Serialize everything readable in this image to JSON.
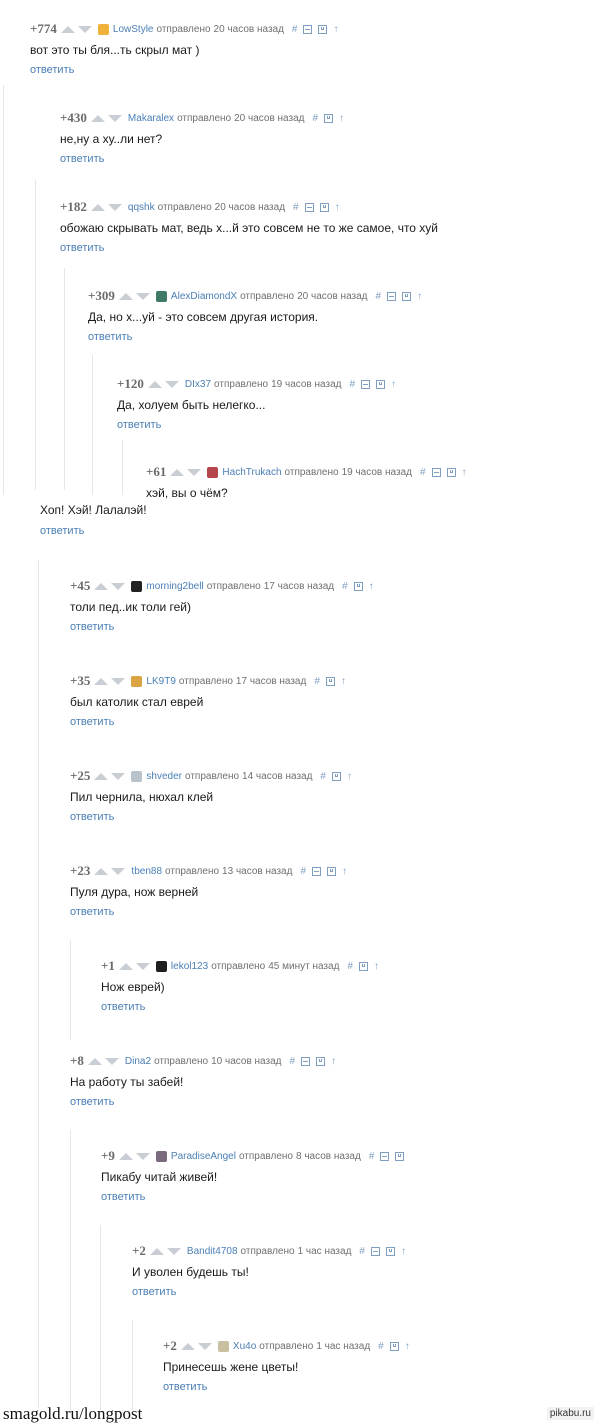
{
  "comments": [
    {
      "score": "+774",
      "nick": "LowStyle",
      "meta": "отправлено",
      "time": "20 часов назад",
      "text": "вот это ты бля...ть скрыл мат )",
      "reply": "ответить",
      "icons": [
        "hash",
        "minus",
        "save",
        "up"
      ],
      "avatar": "#f0b23a"
    },
    {
      "score": "+430",
      "nick": "Makaralex",
      "meta": "отправлено",
      "time": "20 часов назад",
      "text": "не,ну а ху..ли нет?",
      "reply": "ответить",
      "icons": [
        "hash",
        "save",
        "up"
      ],
      "avatar": ""
    },
    {
      "score": "+182",
      "nick": "qqshk",
      "meta": "отправлено",
      "time": "20 часов назад",
      "text": "обожаю скрывать мат, ведь х...й это совсем не то же самое, что хуй",
      "reply": "ответить",
      "icons": [
        "hash",
        "minus",
        "save",
        "up"
      ],
      "avatar": ""
    },
    {
      "score": "+309",
      "nick": "AlexDiamondX",
      "meta": "отправлено",
      "time": "20 часов назад",
      "text": "Да, но х...уй - это совсем другая история.",
      "reply": "ответить",
      "icons": [
        "hash",
        "minus",
        "save",
        "up"
      ],
      "avatar": "#3f7b64"
    },
    {
      "score": "+120",
      "nick": "DIx37",
      "meta": "отправлено",
      "time": "19 часов назад",
      "text": "Да, холуем быть нелегко...",
      "reply": "ответить",
      "icons": [
        "hash",
        "minus",
        "save",
        "up"
      ],
      "avatar": ""
    },
    {
      "score": "+61",
      "nick": "HachTrukach",
      "meta": "отправлено",
      "time": "19 часов назад",
      "text": "хэй, вы о чём?",
      "reply": "",
      "icons": [
        "hash",
        "minus",
        "save",
        "up"
      ],
      "avatar": "#b5474c"
    },
    {
      "score": "+45",
      "nick": "morning2bell",
      "meta": "отправлено",
      "time": "17 часов назад",
      "text": "толи пед..ик толи гей)",
      "reply": "ответить",
      "icons": [
        "hash",
        "save",
        "up"
      ],
      "avatar": "#222222"
    },
    {
      "score": "+35",
      "nick": "LK9T9",
      "meta": "отправлено",
      "time": "17 часов назад",
      "text": "был католик стал еврей",
      "reply": "ответить",
      "icons": [
        "hash",
        "save",
        "up"
      ],
      "avatar": "#d9a441"
    },
    {
      "score": "+25",
      "nick": "shveder",
      "meta": "отправлено",
      "time": "14 часов назад",
      "text": "Пил чернила, нюхал клей",
      "reply": "ответить",
      "icons": [
        "hash",
        "save",
        "up"
      ],
      "avatar": "#b9c3cc"
    },
    {
      "score": "+23",
      "nick": "tben88",
      "meta": "отправлено",
      "time": "13 часов назад",
      "text": "Пуля дура, нож верней",
      "reply": "ответить",
      "icons": [
        "hash",
        "minus",
        "save",
        "up"
      ],
      "avatar": ""
    },
    {
      "score": "+1",
      "nick": "lekol123",
      "meta": "отправлено",
      "time": "45 минут назад",
      "text": "Нож еврей)",
      "reply": "ответить",
      "icons": [
        "hash",
        "save",
        "up"
      ],
      "avatar": "#1e1e1e"
    },
    {
      "score": "+8",
      "nick": "Dina2",
      "meta": "отправлено",
      "time": "10 часов назад",
      "text": "На работу ты забей!",
      "reply": "ответить",
      "icons": [
        "hash",
        "minus",
        "save",
        "up"
      ],
      "avatar": ""
    },
    {
      "score": "+9",
      "nick": "ParadiseAngel",
      "meta": "отправлено",
      "time": "8 часов назад",
      "text": "Пикабу читай живей!",
      "reply": "ответить",
      "icons": [
        "hash",
        "minus",
        "save"
      ],
      "avatar": "#7a6a7e"
    },
    {
      "score": "+2",
      "nick": "Bandit4708",
      "meta": "отправлено",
      "time": "1 час назад",
      "text": "И уволен будешь ты!",
      "reply": "ответить",
      "icons": [
        "hash",
        "minus",
        "save",
        "up"
      ],
      "avatar": ""
    },
    {
      "score": "+2",
      "nick": "Xu4o",
      "meta": "отправлено",
      "time": "1 час назад",
      "text": "Принесешь жене цветы!",
      "reply": "ответить",
      "icons": [
        "hash",
        "save",
        "up"
      ],
      "avatar": "#c8c0a0"
    }
  ],
  "orphan_text": "Хоп! Хэй! Лалалэй!",
  "orphan_reply": "ответить",
  "icon_glyphs": {
    "hash": "#",
    "up": "↑"
  },
  "footer": {
    "left": "smagold.ru/longpost",
    "right": "pikabu.ru"
  }
}
